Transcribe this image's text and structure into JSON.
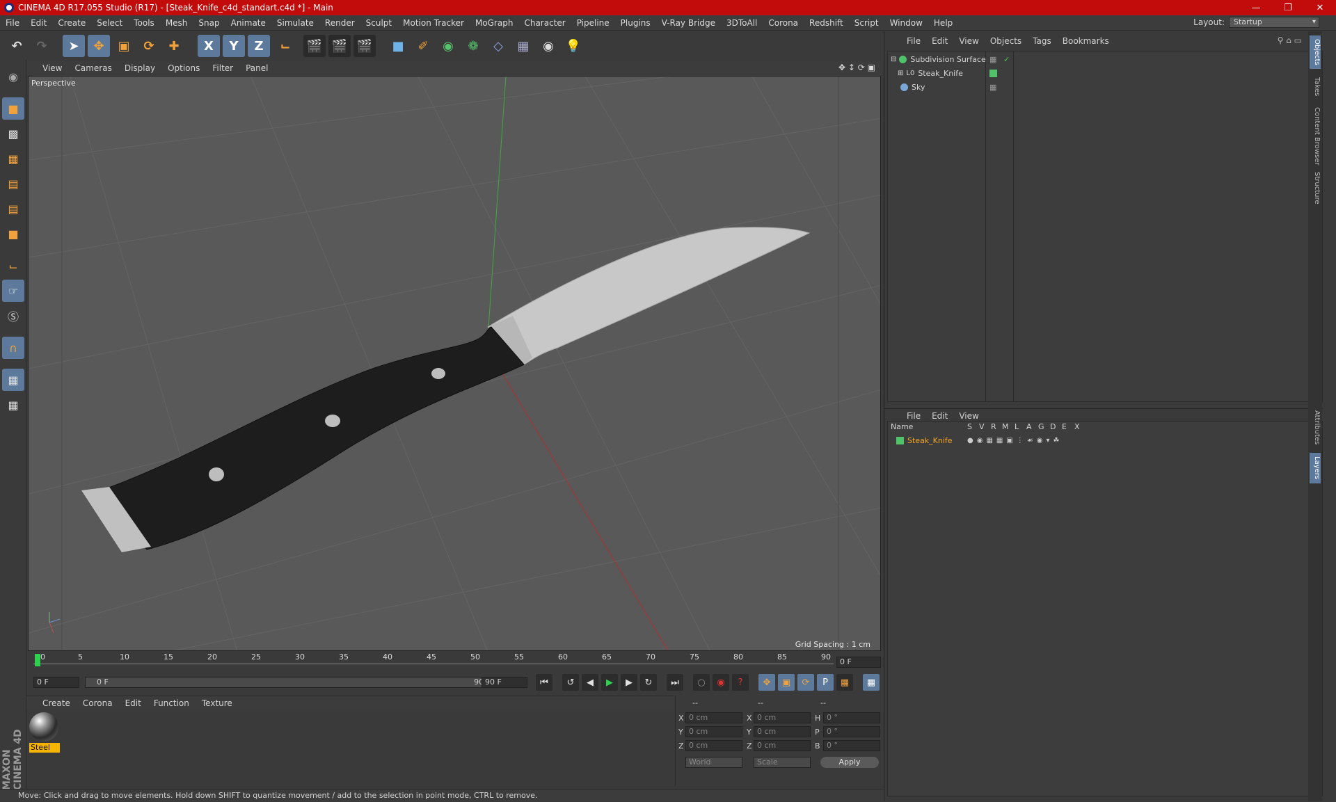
{
  "title": "CINEMA 4D R17.055 Studio (R17) - [Steak_Knife_c4d_standart.c4d *] - Main",
  "menu": [
    "File",
    "Edit",
    "Create",
    "Select",
    "Tools",
    "Mesh",
    "Snap",
    "Animate",
    "Simulate",
    "Render",
    "Sculpt",
    "Motion Tracker",
    "MoGraph",
    "Character",
    "Pipeline",
    "Plugins",
    "V-Ray Bridge",
    "3DToAll",
    "Corona",
    "Redshift",
    "Script",
    "Window",
    "Help"
  ],
  "layout": {
    "label": "Layout:",
    "value": "Startup"
  },
  "toolbar": {
    "x": "X",
    "y": "Y",
    "z": "Z"
  },
  "viewport": {
    "menu": [
      "View",
      "Cameras",
      "Display",
      "Options",
      "Filter",
      "Panel"
    ],
    "label": "Perspective",
    "grid_spacing": "Grid Spacing : 1 cm"
  },
  "timeline": {
    "ticks": [
      "0",
      "5",
      "10",
      "15",
      "20",
      "25",
      "30",
      "35",
      "40",
      "45",
      "50",
      "55",
      "60",
      "65",
      "70",
      "75",
      "80",
      "85",
      "90"
    ],
    "current": "0 F",
    "start": "0 F",
    "range_start": "0 F",
    "range_end": "90 F",
    "end": "90 F"
  },
  "materials": {
    "menu": [
      "Create",
      "Corona",
      "Edit",
      "Function",
      "Texture"
    ],
    "items": [
      {
        "name": "Steel"
      }
    ]
  },
  "coords": {
    "headers": [
      "--",
      "--",
      "--"
    ],
    "rows": [
      {
        "a": "X",
        "av": "0 cm",
        "b": "X",
        "bv": "0 cm",
        "c": "H",
        "cv": "0 °"
      },
      {
        "a": "Y",
        "av": "0 cm",
        "b": "Y",
        "bv": "0 cm",
        "c": "P",
        "cv": "0 °"
      },
      {
        "a": "Z",
        "av": "0 cm",
        "b": "Z",
        "bv": "0 cm",
        "c": "B",
        "cv": "0 °"
      }
    ],
    "world": "World",
    "scale": "Scale",
    "apply": "Apply"
  },
  "status": "Move: Click and drag to move elements. Hold down SHIFT to quantize movement / add to the selection in point mode, CTRL to remove.",
  "objects": {
    "menu": [
      "File",
      "Edit",
      "View",
      "Objects",
      "Tags",
      "Bookmarks"
    ],
    "items": [
      {
        "name": "Subdivision Surface",
        "color": "#4fc26a"
      },
      {
        "name": "Steak_Knife",
        "color": "#bbbbbb"
      },
      {
        "name": "Sky",
        "color": "#7aa7d8"
      }
    ]
  },
  "layers": {
    "menu": [
      "File",
      "Edit",
      "View"
    ],
    "header": {
      "name": "Name",
      "cols": [
        "S",
        "V",
        "R",
        "M",
        "L",
        "A",
        "G",
        "D",
        "E",
        "X"
      ]
    },
    "items": [
      {
        "name": "Steak_Knife",
        "color": "#4fc26a"
      }
    ]
  },
  "side_tabs": [
    "Objects",
    "Takes",
    "Content Browser",
    "Structure",
    "Attributes",
    "Layers"
  ],
  "brand": "MAXON CINEMA 4D"
}
